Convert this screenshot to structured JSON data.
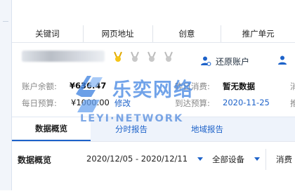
{
  "nav": {
    "items": [
      {
        "label": "关键词"
      },
      {
        "label": "网页地址"
      },
      {
        "label": "创意"
      },
      {
        "label": "推广单元"
      }
    ]
  },
  "account": {
    "restore_label": "还原账户",
    "balance_label": "账户余额:",
    "balance_value": "¥636.47",
    "budget_label": "每日预算:",
    "budget_value": "¥1000.00",
    "edit_label": "修改",
    "yesterday_label": "昨日消费:",
    "yesterday_value": "暂无数据",
    "arrival_label": "到达预算:",
    "arrival_value": "2020-11-25",
    "extra_label_1": "消",
    "extra_label_2": "推"
  },
  "watermark": {
    "title": "乐奕网络",
    "subtitle": "LEYI·NETWORK"
  },
  "tabs": [
    {
      "label": "数据概览",
      "active": true
    },
    {
      "label": "分时报告",
      "active": false
    },
    {
      "label": "地域报告",
      "active": false
    }
  ],
  "filter": {
    "title": "数据概览",
    "date_range": "2020/12/05 - 2020/12/11",
    "device": "全部设备",
    "metric": "消费"
  },
  "colors": {
    "accent": "#1d62c9",
    "tab_bar": "#eef3fb",
    "watermark_blue": "#3a7fe0"
  }
}
